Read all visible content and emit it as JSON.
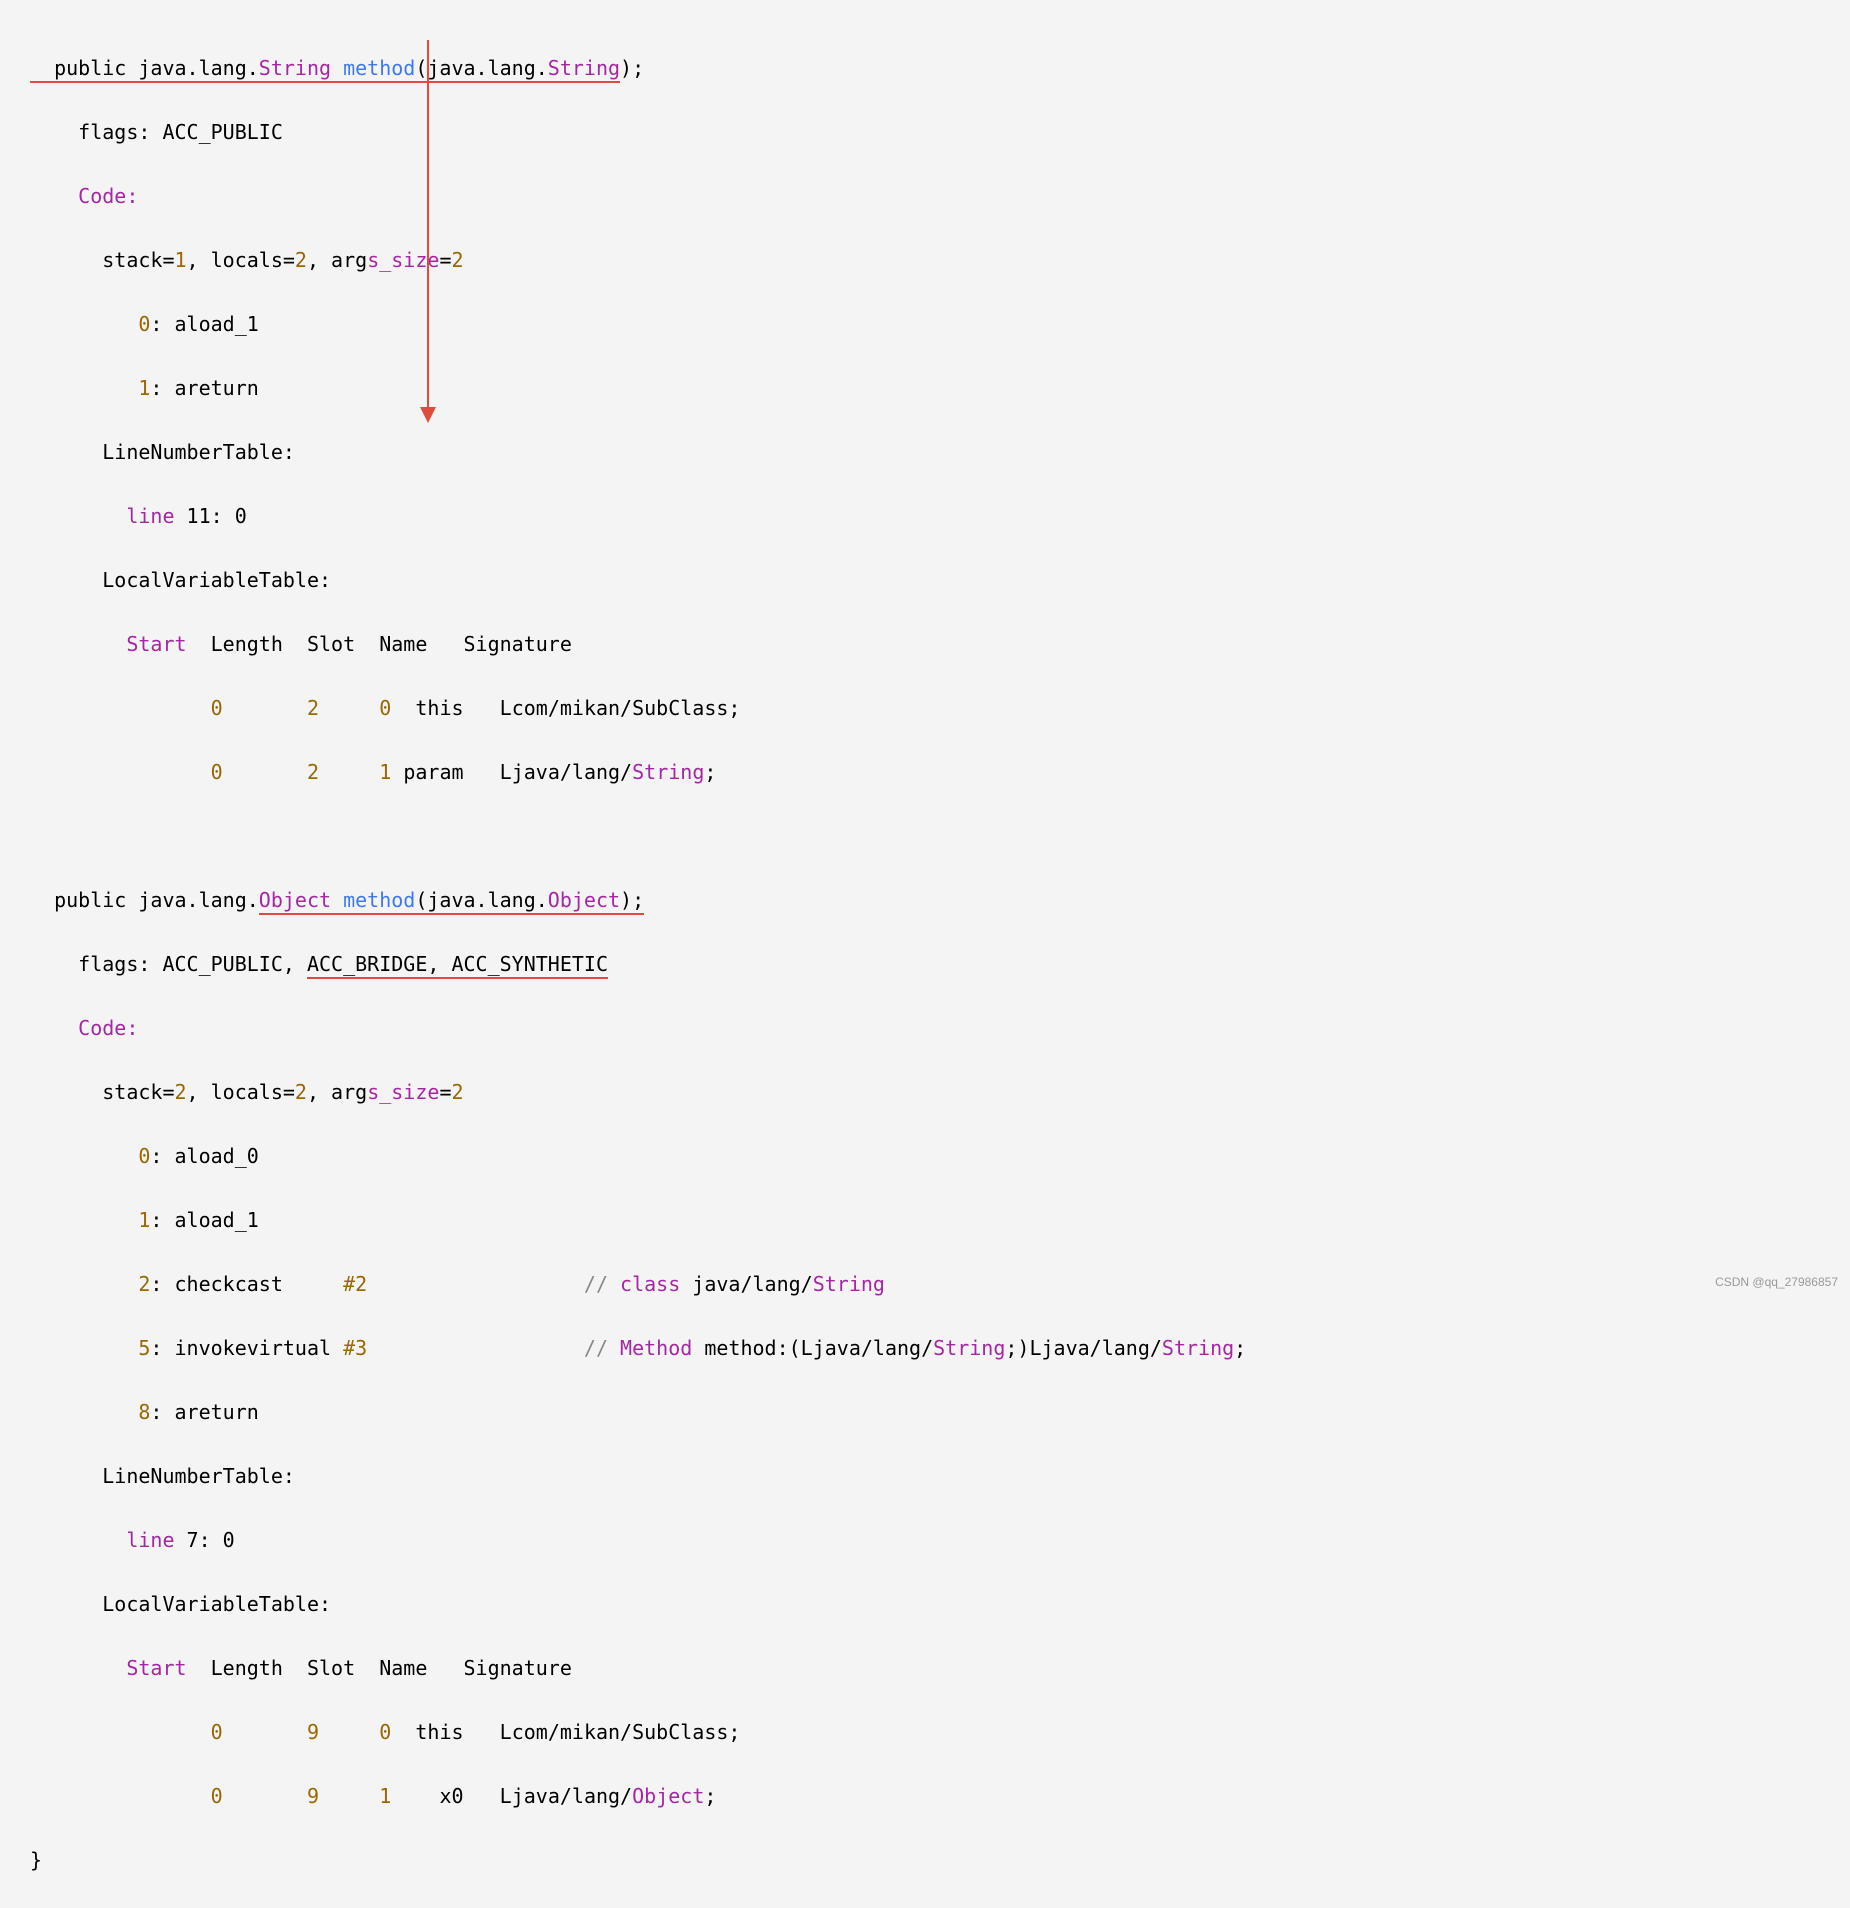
{
  "method1": {
    "sig_pre": "  public java.lang.",
    "sig_ret": "String",
    "sig_mid": " ",
    "sig_name": "method",
    "sig_open": "(java.lang.",
    "sig_param": "String",
    "sig_close": ");",
    "flags": "    flags: ACC_PUBLIC",
    "code_label": "    Code:",
    "stack_pre": "      stack=",
    "stack_v": "1",
    "locals_pre": ", locals=",
    "locals_v": "2",
    "args_pre": ", arg",
    "args_mid": "s_size",
    "args_eq": "=",
    "args_v": "2",
    "instr0_pre": "         ",
    "instr0_n": "0",
    "instr0_txt": ": aload_1",
    "instr1_pre": "         ",
    "instr1_n": "1",
    "instr1_txt": ": areturn",
    "lnt": "      LineNumberTable:",
    "lnt_line_pre": "        ",
    "lnt_line_kw": "line",
    "lnt_line_rest": " 11: 0",
    "lvt": "      LocalVariableTable:",
    "lvt_hdr_pre": "        ",
    "lvt_hdr_start": "Start",
    "lvt_hdr_rest": "  Length  Slot  Name   Signature",
    "lvt_r1_pre": "               ",
    "lvt_r1_c1": "0",
    "lvt_r1_sp1": "       ",
    "lvt_r1_c2": "2",
    "lvt_r1_sp2": "     ",
    "lvt_r1_c3_a": "0",
    "lvt_r1_c3_b": "  this   Lcom/mikan/SubClass;",
    "lvt_r2_pre": "               ",
    "lvt_r2_c1": "0",
    "lvt_r2_sp1": "       ",
    "lvt_r2_c2": "2",
    "lvt_r2_sp2": "     ",
    "lvt_r2_c3_a": "1",
    "lvt_r2_c3_b": " param   Ljava/lang/",
    "lvt_r2_c3_c": "String",
    "lvt_r2_c3_d": ";"
  },
  "method2": {
    "sig_pre": "  public java.lang.",
    "sig_ret": "Object",
    "sig_mid": " ",
    "sig_name": "method",
    "sig_open": "(java.lang.",
    "sig_param": "Object",
    "sig_close": ");",
    "flags_pre": "    flags: ACC_PUBLIC, ",
    "flags_ul": "ACC_BRIDGE, ACC_SYNTHETIC",
    "code_label": "    Code:",
    "stack_pre": "      stack=",
    "stack_v": "2",
    "locals_pre": ", locals=",
    "locals_v": "2",
    "args_pre": ", arg",
    "args_mid": "s_size",
    "args_eq": "=",
    "args_v": "2",
    "i0_pre": "         ",
    "i0_n": "0",
    "i0_txt": ": aload_0",
    "i1_pre": "         ",
    "i1_n": "1",
    "i1_txt": ": aload_1",
    "i2_pre": "         ",
    "i2_n": "2",
    "i2_txt": ": checkcast     ",
    "i2_ref": "#2",
    "i2_pad": "                  ",
    "i2_cmt_a": "// ",
    "i2_cmt_b": "class",
    "i2_cmt_c": " java/lang/",
    "i2_cmt_d": "String",
    "i5_pre": "         ",
    "i5_n": "5",
    "i5_txt": ": invokevirtual ",
    "i5_ref": "#3",
    "i5_pad": "                  ",
    "i5_cmt_a": "// ",
    "i5_cmt_b": "Method",
    "i5_cmt_c": " method:(Ljava/lang/",
    "i5_cmt_d": "String",
    "i5_cmt_e": ";)Ljava/lang/",
    "i5_cmt_f": "String",
    "i5_cmt_g": ";",
    "i8_pre": "         ",
    "i8_n": "8",
    "i8_txt": ": areturn",
    "lnt": "      LineNumberTable:",
    "lnt_line_pre": "        ",
    "lnt_line_kw": "line",
    "lnt_line_rest": " 7: 0",
    "lvt": "      LocalVariableTable:",
    "lvt_hdr_pre": "        ",
    "lvt_hdr_start": "Start",
    "lvt_hdr_rest": "  Length  Slot  Name   Signature",
    "lvt_r1_pre": "               ",
    "lvt_r1_c1": "0",
    "lvt_r1_sp1": "       ",
    "lvt_r1_c2": "9",
    "lvt_r1_sp2": "     ",
    "lvt_r1_c3": "0",
    "lvt_r1_rest": "  this   Lcom/mikan/SubClass;",
    "lvt_r2_pre": "               ",
    "lvt_r2_c1": "0",
    "lvt_r2_sp1": "       ",
    "lvt_r2_c2": "9",
    "lvt_r2_sp2": "     ",
    "lvt_r2_c3": "1",
    "lvt_r2_rest_a": "    x0   Ljava/lang/",
    "lvt_r2_rest_b": "Object",
    "lvt_r2_rest_c": ";"
  },
  "closing_brace": "}",
  "watermark": "CSDN @qq_27986857",
  "annotations": {
    "arrow_color": "#e04c3c"
  }
}
